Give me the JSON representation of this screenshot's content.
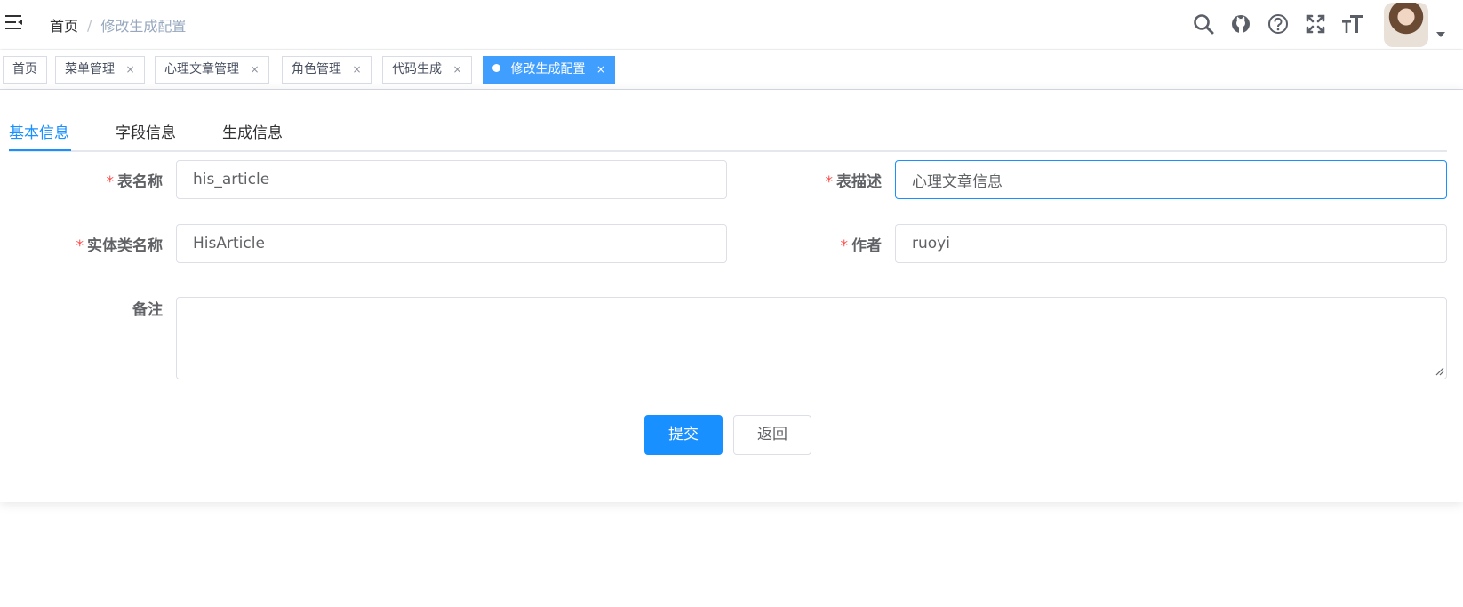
{
  "breadcrumb": {
    "home": "首页",
    "separator": "/",
    "current": "修改生成配置"
  },
  "right_menu": {
    "icons": [
      "search-icon",
      "github-icon",
      "question-icon",
      "fullscreen-icon",
      "font-size-icon"
    ]
  },
  "tags": [
    {
      "label": "首页",
      "closable": false
    },
    {
      "label": "菜单管理",
      "close": "×"
    },
    {
      "label": "心理文章管理",
      "close": "×"
    },
    {
      "label": "角色管理",
      "close": "×"
    },
    {
      "label": "代码生成",
      "close": "×"
    },
    {
      "label": "修改生成配置",
      "close": "×",
      "active": true
    }
  ],
  "tabs": [
    {
      "label": "基本信息",
      "active": true
    },
    {
      "label": "字段信息"
    },
    {
      "label": "生成信息"
    }
  ],
  "form": {
    "required_mark": "*",
    "table_name": {
      "label": "表名称",
      "value": "his_article"
    },
    "table_comment": {
      "label": "表描述",
      "value": "心理文章信息"
    },
    "class_name": {
      "label": "实体类名称",
      "value": "HisArticle"
    },
    "author": {
      "label": "作者",
      "value": "ruoyi"
    },
    "remark": {
      "label": "备注",
      "value": ""
    }
  },
  "buttons": {
    "submit": "提交",
    "back": "返回"
  },
  "colors": {
    "primary": "#1890ff",
    "tag_active": "#409eff",
    "required": "#ff4949"
  }
}
